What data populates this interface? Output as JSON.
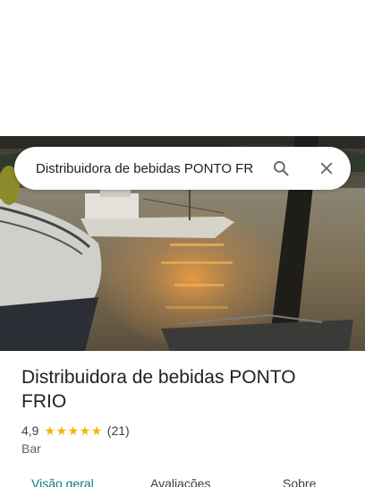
{
  "search": {
    "query": "Distribuidora de bebidas PONTO FR",
    "search_icon": "search-icon",
    "close_icon": "close-icon"
  },
  "photo": {
    "description_icon": "place-photo"
  },
  "place": {
    "name": "Distribuidora de bebidas PONTO FRIO",
    "rating": "4,9",
    "stars": 5,
    "review_count": "(21)",
    "category": "Bar"
  },
  "tabs": [
    {
      "label": "Visão geral",
      "active": true
    },
    {
      "label": "Avaliações",
      "active": false
    },
    {
      "label": "Sobre",
      "active": false
    }
  ],
  "colors": {
    "accent": "#0b7b83",
    "star": "#f4b400"
  }
}
